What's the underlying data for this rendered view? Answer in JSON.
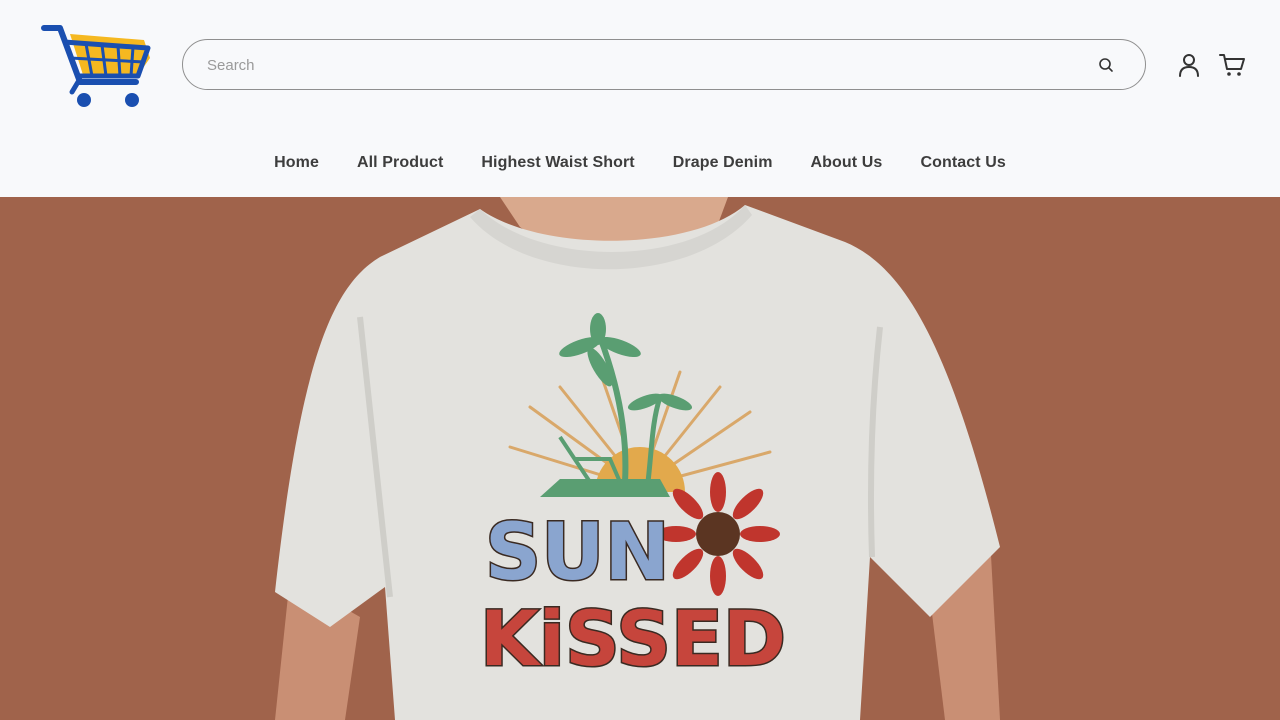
{
  "header": {
    "search": {
      "placeholder": "Search",
      "value": ""
    }
  },
  "nav": {
    "items": [
      {
        "label": "Home"
      },
      {
        "label": "All Product"
      },
      {
        "label": "Highest Waist Short"
      },
      {
        "label": "Drape Denim"
      },
      {
        "label": "About Us"
      },
      {
        "label": "Contact Us"
      }
    ]
  },
  "hero": {
    "background_color": "#a0634b",
    "shirt_graphic": {
      "line1": "SUN",
      "line2": "KiSSED"
    }
  },
  "icons": {
    "logo": "shopping-cart-logo",
    "search": "search-icon",
    "account": "user-icon",
    "cart": "cart-icon"
  }
}
